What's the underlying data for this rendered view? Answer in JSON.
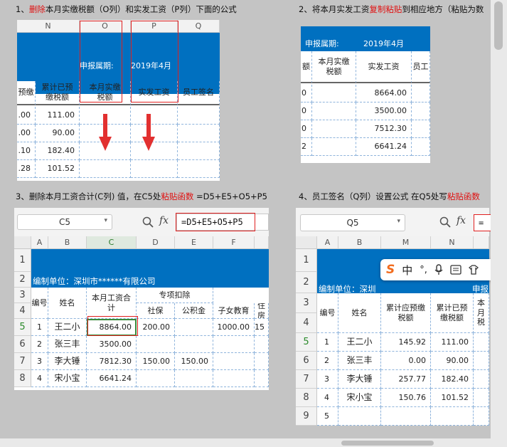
{
  "titles": {
    "t1a": "1、",
    "t1red": "删除",
    "t1b": "本月实缴税额（O列）和实发工资（P列）下面的公式",
    "t2a": "2、将本月实发工资",
    "t2red": "复制粘贴",
    "t2b": "到相应地方（粘贴为数",
    "t3a": "3、删除本月工资合计(C列) 值，在C5处",
    "t3red": "粘贴函数",
    "t3b": "  =D5+E5+O5+P5",
    "t4a": "4、员工签名（Q列）设置公式 在Q5处写",
    "t4red": "粘贴函数"
  },
  "p1": {
    "cols": [
      "N",
      "O",
      "P",
      "Q"
    ],
    "period_label": "申报属期:",
    "period_value": "2019年4月",
    "headers": [
      "预缴",
      "累计已预\n缴税额",
      "本月实缴\n税额",
      "实发工资",
      "员工签名"
    ],
    "rows": [
      [
        ".00",
        "111.00"
      ],
      [
        ".00",
        "90.00"
      ],
      [
        ".10",
        "182.40"
      ],
      [
        ".28",
        "101.52"
      ]
    ]
  },
  "p2": {
    "period_label": "申报属期:",
    "period_value": "2019年4月",
    "headers": [
      "额",
      "本月实缴\n税额",
      "实发工资",
      "员工"
    ],
    "rows": [
      [
        "0",
        "8664.00"
      ],
      [
        "0",
        "3500.00"
      ],
      [
        "0",
        "7512.30"
      ],
      [
        "2",
        "6641.24"
      ]
    ]
  },
  "p3": {
    "namebox": "C5",
    "fx": "fx",
    "formula": "=D5+E5+O5+P5",
    "cols": [
      "A",
      "B",
      "C",
      "D",
      "E",
      "F"
    ],
    "rownums": [
      "1",
      "2",
      "3",
      "4",
      "5",
      "6",
      "7",
      "8"
    ],
    "company": "编制单位：深圳市******有限公司",
    "h_no": "编号",
    "h_name": "姓名",
    "h_total": "本月工资合\n计",
    "h_special": "专项扣除",
    "h_sb": "社保",
    "h_gjj": "公积金",
    "h_child": "子女教育",
    "h_house": "住房",
    "rows": [
      {
        "no": "1",
        "name": "王二小",
        "total": "8864.00",
        "sb": "200.00",
        "gjj": "",
        "child": "1000.00",
        "house": "15"
      },
      {
        "no": "2",
        "name": "张三丰",
        "total": "3500.00",
        "sb": "",
        "gjj": "",
        "child": "",
        "house": ""
      },
      {
        "no": "3",
        "name": "李大锤",
        "total": "7812.30",
        "sb": "150.00",
        "gjj": "150.00",
        "child": "",
        "house": ""
      },
      {
        "no": "4",
        "name": "宋小宝",
        "total": "6641.24",
        "sb": "",
        "gjj": "",
        "child": "",
        "house": ""
      }
    ]
  },
  "p4": {
    "namebox": "Q5",
    "fx": "fx",
    "formula": "=",
    "cols": [
      "A",
      "B",
      "M",
      "N"
    ],
    "rownums": [
      "1",
      "2",
      "3",
      "4",
      "5",
      "6",
      "7",
      "8",
      "9"
    ],
    "company": "编制单位：深圳",
    "period_label": "申报",
    "h_no": "编号",
    "h_name": "姓名",
    "h_m": "累计应预缴\n税额",
    "h_n": "累计已预\n缴税额",
    "h_o": "本月\n税",
    "rows": [
      {
        "no": "1",
        "name": "王二小",
        "m": "145.92",
        "n": "111.00"
      },
      {
        "no": "2",
        "name": "张三丰",
        "m": "0.00",
        "n": "90.00"
      },
      {
        "no": "3",
        "name": "李大锤",
        "m": "257.77",
        "n": "182.40"
      },
      {
        "no": "4",
        "name": "宋小宝",
        "m": "150.76",
        "n": "101.52"
      },
      {
        "no": "5",
        "name": "",
        "m": "",
        "n": ""
      }
    ],
    "ime": {
      "logo": "S",
      "zh": "中",
      "punct": "°,",
      "mic": "mic-icon",
      "kb": "keyboard-icon",
      "skin": "shirt-icon"
    }
  }
}
